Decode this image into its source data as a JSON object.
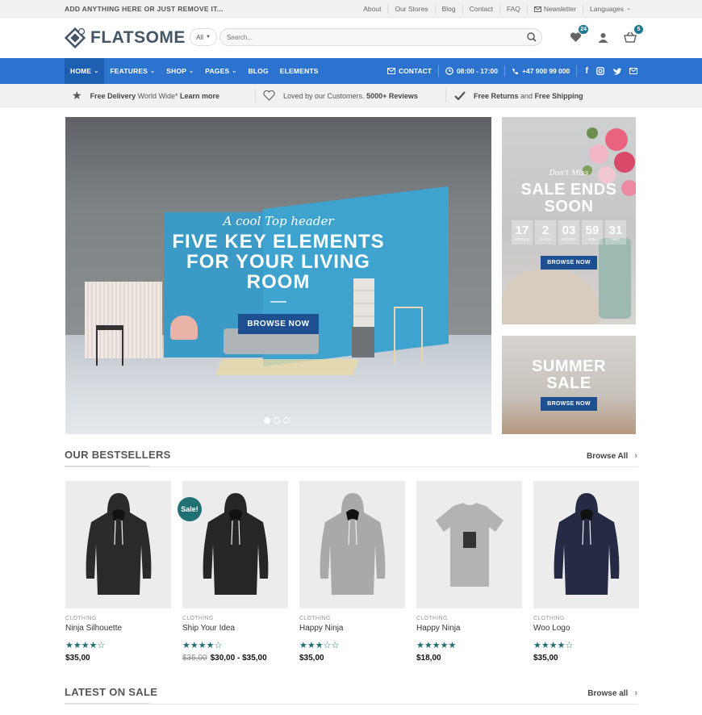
{
  "topbar": {
    "message": "ADD ANYTHING HERE OR JUST REMOVE IT...",
    "links": [
      "About",
      "Our Stores",
      "Blog",
      "Contact",
      "FAQ",
      "Newsletter",
      "Languages"
    ]
  },
  "header": {
    "logo_text": "FLATSOME",
    "search_category": "All",
    "search_placeholder": "Search...",
    "wishlist_count": "24",
    "cart_count": "5"
  },
  "nav": {
    "items": [
      "HOME",
      "FEATURES",
      "SHOP",
      "PAGES",
      "BLOG",
      "ELEMENTS"
    ],
    "contact": "CONTACT",
    "hours": "08:00 - 17:00",
    "phone": "+47 900 99 000"
  },
  "usp": [
    {
      "pre": "Free Delivery",
      "mid": " World Wide* ",
      "post": "Learn more"
    },
    {
      "pre": "Loved by our Customers. ",
      "mid": "",
      "post": "5000+ Reviews"
    },
    {
      "pre": "Free Returns",
      "mid": " and ",
      "post": "Free Shipping"
    }
  ],
  "hero": {
    "kicker": "A cool Top header",
    "title_line1": "FIVE KEY ELEMENTS",
    "title_line2": "FOR YOUR LIVING",
    "title_line3": "ROOM",
    "button": "BROWSE NOW"
  },
  "side1": {
    "kicker": "Don't Miss",
    "title_line1": "SALE ENDS",
    "title_line2": "SOON",
    "countdown": [
      {
        "n": "17",
        "l": "WEEKS"
      },
      {
        "n": "2",
        "l": "DAYS"
      },
      {
        "n": "03",
        "l": "HOURS"
      },
      {
        "n": "59",
        "l": "MIN"
      },
      {
        "n": "31",
        "l": "SEC"
      }
    ],
    "button": "BROWSE NOW"
  },
  "side2": {
    "title_line1": "SUMMER",
    "title_line2": "SALE",
    "button": "BROWSE NOW"
  },
  "bestsellers": {
    "title": "OUR BESTSELLERS",
    "browse": "Browse All"
  },
  "products": [
    {
      "cat": "CLOTHING",
      "name": "Ninja Silhouette",
      "rating": 4,
      "price": "$35,00",
      "old": "",
      "sale": "",
      "garment": "hoodie",
      "color": "#2a2a2a"
    },
    {
      "cat": "CLOTHING",
      "name": "Ship Your Idea",
      "rating": 4,
      "price": "$30,00 - $35,00",
      "old": "$35,00",
      "sale": "Sale!",
      "garment": "hoodie",
      "color": "#262626"
    },
    {
      "cat": "CLOTHING",
      "name": "Happy Ninja",
      "rating": 3,
      "price": "$35,00",
      "old": "",
      "sale": "",
      "garment": "hoodie",
      "color": "#a9a9a9"
    },
    {
      "cat": "CLOTHING",
      "name": "Happy Ninja",
      "rating": 5,
      "price": "$18,00",
      "old": "",
      "sale": "",
      "garment": "tshirt",
      "color": "#b3b3b3"
    },
    {
      "cat": "CLOTHING",
      "name": "Woo Logo",
      "rating": 4,
      "price": "$35,00",
      "old": "",
      "sale": "",
      "garment": "hoodie",
      "color": "#252a45"
    }
  ],
  "latest": {
    "title": "LATEST ON SALE",
    "browse": "Browse all"
  },
  "colors": {
    "nav_blue": "#2c73cf",
    "button_blue": "#1d4f91",
    "teal": "#1f6f73"
  }
}
